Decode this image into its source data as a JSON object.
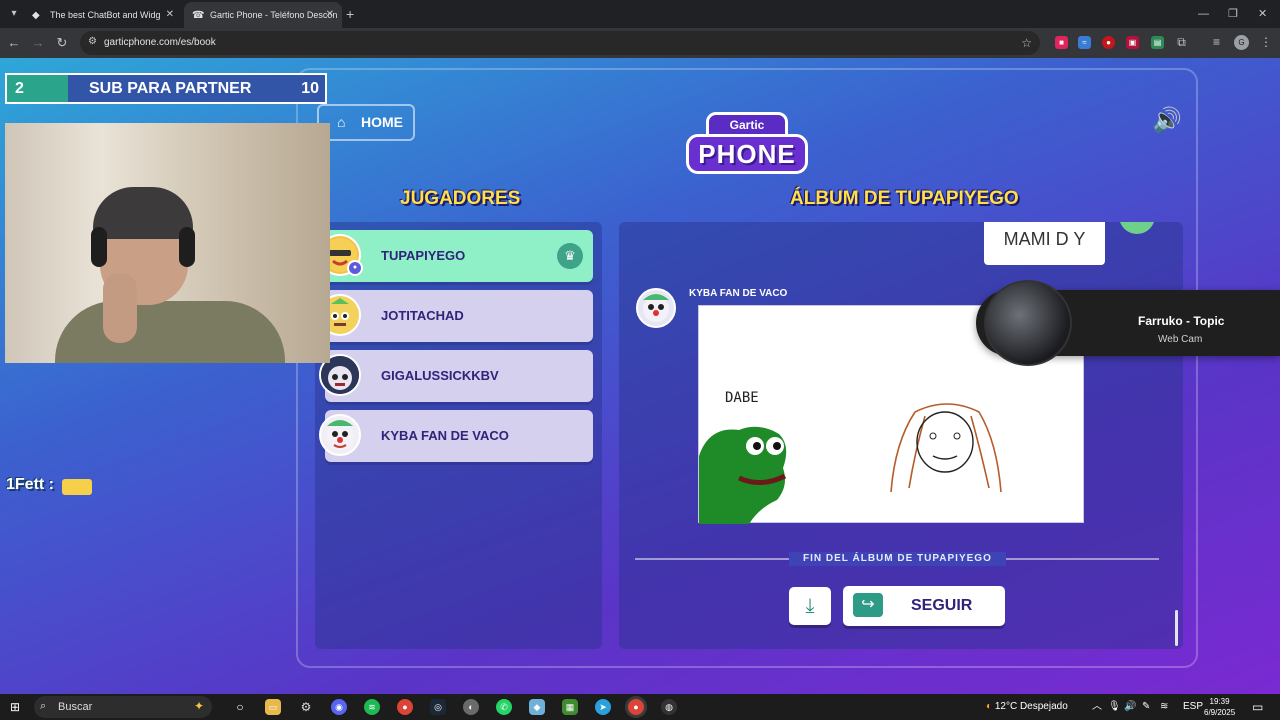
{
  "browser": {
    "tabs": [
      {
        "title": "The best ChatBot and Widg",
        "active": false
      },
      {
        "title": "Gartic Phone - Teléfono Descon",
        "active": true
      }
    ],
    "url": "garticphone.com/es/book"
  },
  "game": {
    "home_label": "HOME",
    "logo_top": "Gartic",
    "logo_bottom": "PHONE",
    "players_heading": "JUGADORES",
    "album_heading": "ÁLBUM DE TUPAPIYEGO",
    "players": [
      {
        "name": "TUPAPIYEGO",
        "host": true
      },
      {
        "name": "JOTITACHAD",
        "host": false
      },
      {
        "name": "GIGALUSSICKKBV",
        "host": false
      },
      {
        "name": "KYBA FAN DE VACO",
        "host": false
      }
    ],
    "prev_text": "MAMI D Y",
    "author": "KYBA FAN DE VACO",
    "drawing_text": "DABE",
    "end_text": "FIN DEL ÁLBUM DE TUPAPIYEGO",
    "seguir_label": "SEGUIR"
  },
  "overlay": {
    "sub_goal_current": "2",
    "sub_goal_label": "SUB PARA PARTNER",
    "sub_goal_target": "10",
    "chat_text": "1Fett :",
    "media_title": "Farruko - Topic",
    "media_subtitle": "Web Cam"
  },
  "taskbar": {
    "search_placeholder": "Buscar",
    "weather": "12°C  Despejado",
    "lang": "ESP",
    "time": "19:39",
    "date": "6/9/2025"
  }
}
